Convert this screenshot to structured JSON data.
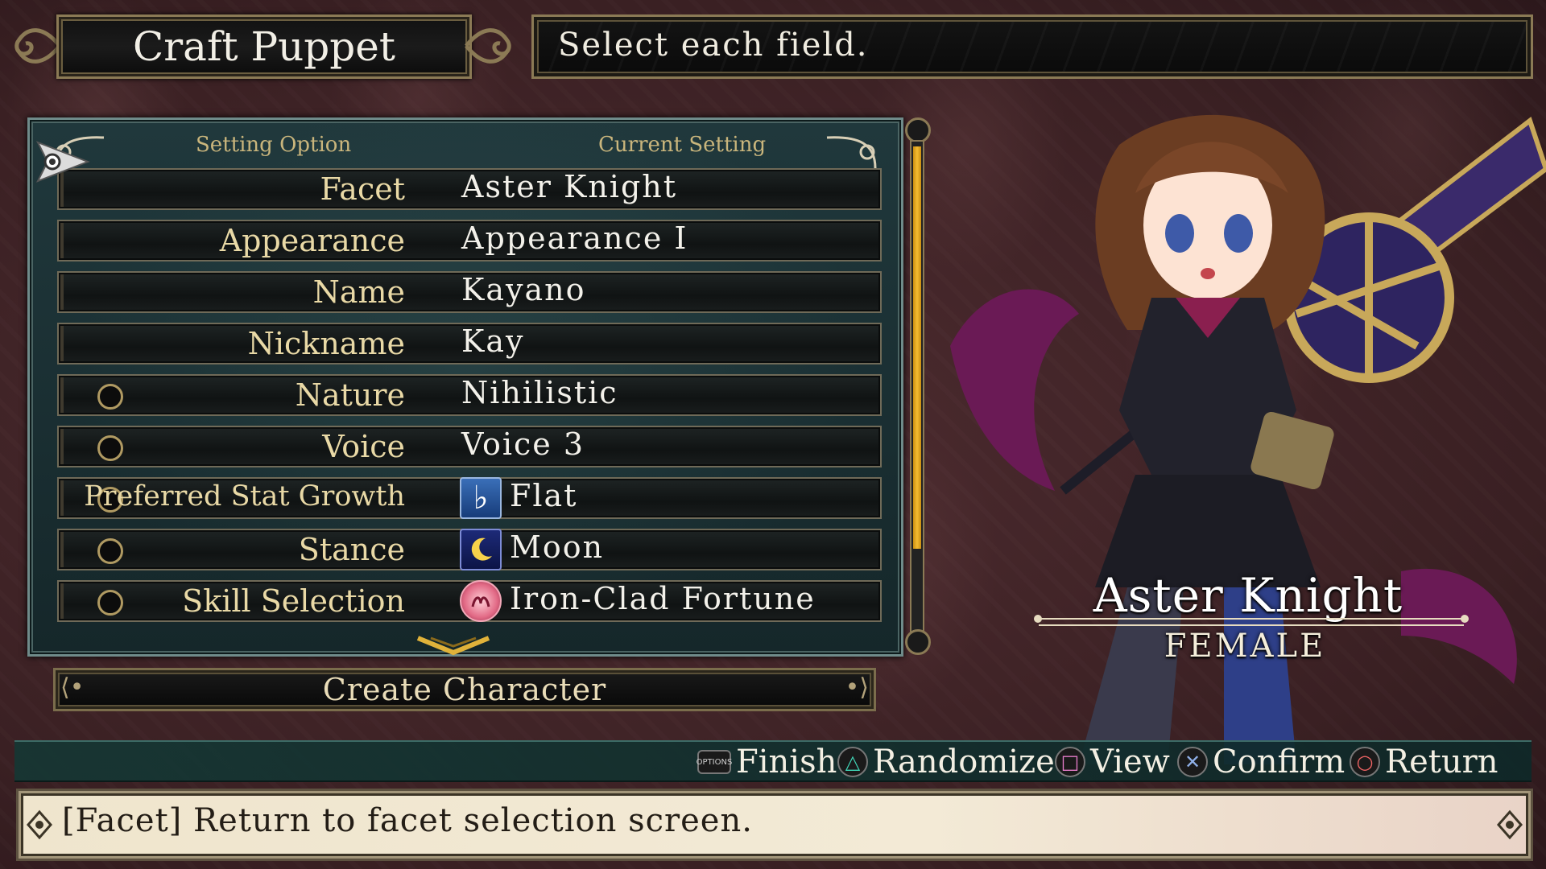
{
  "title": "Craft Puppet",
  "header_instruction": "Select each field.",
  "columns": {
    "setting_option": "Setting Option",
    "current_setting": "Current Setting"
  },
  "rows": [
    {
      "label": "Facet",
      "value": "Aster Knight",
      "has_marker": false,
      "icon": null,
      "selected": true
    },
    {
      "label": "Appearance",
      "value": "Appearance I",
      "has_marker": false,
      "icon": null
    },
    {
      "label": "Name",
      "value": "Kayano",
      "has_marker": false,
      "icon": null
    },
    {
      "label": "Nickname",
      "value": "Kay",
      "has_marker": false,
      "icon": null
    },
    {
      "label": "Nature",
      "value": "Nihilistic",
      "has_marker": true,
      "icon": null
    },
    {
      "label": "Voice",
      "value": "Voice 3",
      "has_marker": true,
      "icon": null
    },
    {
      "label": "Preferred Stat Growth",
      "value": "Flat",
      "has_marker": true,
      "icon": "flat-note-icon"
    },
    {
      "label": "Stance",
      "value": "Moon",
      "has_marker": true,
      "icon": "moon-icon"
    },
    {
      "label": "Skill Selection",
      "value": "Iron-Clad Fortune",
      "has_marker": true,
      "icon": "skill-emblem-icon"
    }
  ],
  "create_button": "Create Character",
  "character": {
    "facet": "Aster Knight",
    "gender": "FEMALE"
  },
  "controls": [
    {
      "icon": "options-button-icon",
      "glyph": "OPTIONS",
      "label": "Finish"
    },
    {
      "icon": "triangle-button-icon",
      "glyph": "△",
      "label": "Randomize"
    },
    {
      "icon": "square-button-icon",
      "glyph": "□",
      "label": "View"
    },
    {
      "icon": "cross-button-icon",
      "glyph": "✕",
      "label": "Confirm"
    },
    {
      "icon": "circle-button-icon",
      "glyph": "○",
      "label": "Return"
    }
  ],
  "description": "[Facet] Return to facet selection screen.",
  "colors": {
    "background": "#3e2326",
    "panel": "#1b2f32",
    "label_gold": "#e9d9a6",
    "scroll_thumb": "#f4bc30",
    "description_bg": "#efe5cd"
  }
}
